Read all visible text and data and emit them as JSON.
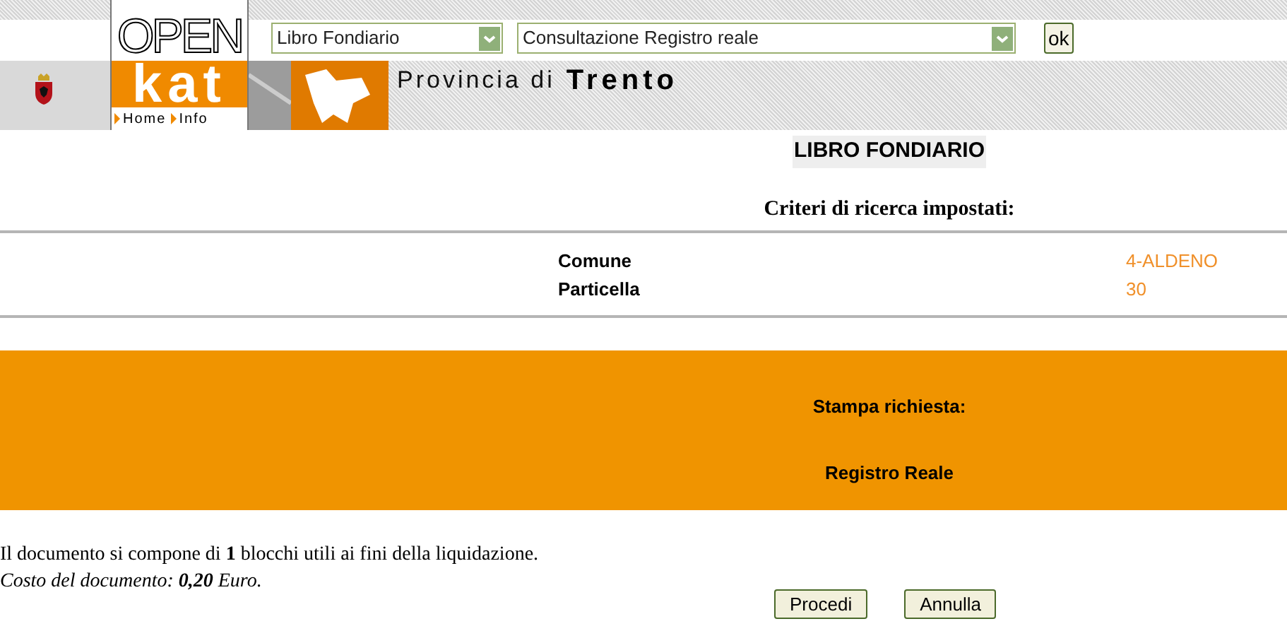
{
  "header": {
    "logo_top": "OPEN",
    "logo_bottom": "kat",
    "nav_links": [
      {
        "label": "Home"
      },
      {
        "label": "Info"
      }
    ],
    "selects": [
      {
        "value": "Libro Fondiario"
      },
      {
        "value": "Consultazione Registro reale"
      }
    ],
    "ok_button": "ok",
    "banner_prefix": "Provincia di",
    "banner_name": "Trento"
  },
  "title": "LIBRO FONDIARIO",
  "criteria": {
    "heading": "Criteri di ricerca impostati:",
    "rows": [
      {
        "label": "Comune",
        "value": "4-ALDENO"
      },
      {
        "label": "Particella",
        "value": "30"
      }
    ]
  },
  "print_panel": {
    "heading": "Stampa richiesta:",
    "document": "Registro Reale"
  },
  "summary": "Il documento si compone di **1** blocchi utili ai fini della liquidazione.",
  "cost": "Costo del documento: **0,20** Euro.",
  "buttons": [
    "Procedi",
    "Annulla"
  ]
}
